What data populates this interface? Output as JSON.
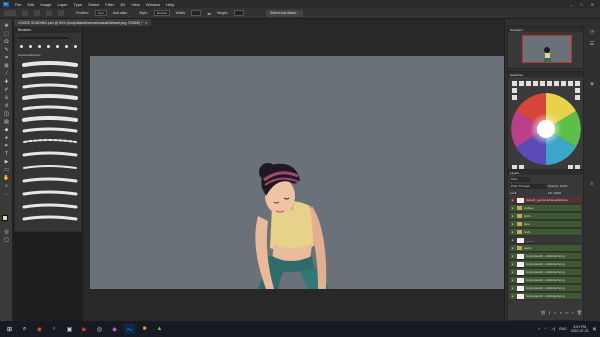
{
  "menubar": {
    "logo": "Ps",
    "items": [
      "File",
      "Edit",
      "Image",
      "Layer",
      "Type",
      "Select",
      "Filter",
      "3D",
      "View",
      "Window",
      "Help"
    ],
    "window_controls": [
      "–",
      "□",
      "✕"
    ]
  },
  "options": {
    "feather_label": "Feather:",
    "feather_value": "0 px",
    "antialias_label": "Anti-alias",
    "style_label": "Style:",
    "style_value": "Normal",
    "width_label": "Width:",
    "height_label": "Height:",
    "select_mask_label": "Select and Mask..."
  },
  "document": {
    "tab_title": "CHASE SHADING.psd @ 50% (body/stand/normal/casual/default.png, RGB/8) *",
    "tab_close": "×"
  },
  "brushes": {
    "title": "Brushes",
    "preset_label": "General Brushes"
  },
  "panels": {
    "navigator_title": "Navigator",
    "swatches_title": "Swatches",
    "layers_title": "Layers",
    "kind_label": "Kind",
    "blend_mode": "Pass Through",
    "opacity_label": "Opacity: 100%",
    "lock_label": "Lock:",
    "fill_label": "Fill: 100%"
  },
  "layers": [
    {
      "name": "default_ garment/casual/shame",
      "type": "layer",
      "highlight": "red"
    },
    {
      "name": "clothes",
      "type": "folder",
      "highlight": "green"
    },
    {
      "name": "arms",
      "type": "folder",
      "highlight": "green"
    },
    {
      "name": "face",
      "type": "folder",
      "highlight": "green"
    },
    {
      "name": "body",
      "type": "folder",
      "highlight": "green"
    },
    {
      "name": "_____",
      "type": "layer",
      "highlight": "none"
    },
    {
      "name": "pants",
      "type": "folder",
      "highlight": "green"
    },
    {
      "name": "body/stand/n...ult/default.png",
      "type": "layer",
      "highlight": "green"
    },
    {
      "name": "body/stand/n...ult/default.png",
      "type": "layer",
      "highlight": "green"
    },
    {
      "name": "body/stand/n...ult/default.png",
      "type": "layer",
      "highlight": "green"
    },
    {
      "name": "body/stand/n...ult/default.png",
      "type": "layer",
      "highlight": "green"
    },
    {
      "name": "body/stand/n...ult/default.png",
      "type": "layer",
      "highlight": "green"
    },
    {
      "name": "body/stand/n...ult/default.png",
      "type": "layer",
      "highlight": "green"
    }
  ],
  "taskbar": {
    "apps": [
      "windows-icon",
      "search-icon",
      "chrome-icon",
      "edge-icon",
      "app-icon",
      "youtube-icon",
      "steam-icon",
      "app-icon",
      "photoshop-icon",
      "app-icon",
      "app-icon"
    ],
    "lang": "ENG",
    "time": "3:01 PM",
    "date": "2022-07-21"
  },
  "colors": {
    "artboard": "#6b7178",
    "accent_green": "#3f5a33",
    "accent_red": "#5a3232"
  }
}
